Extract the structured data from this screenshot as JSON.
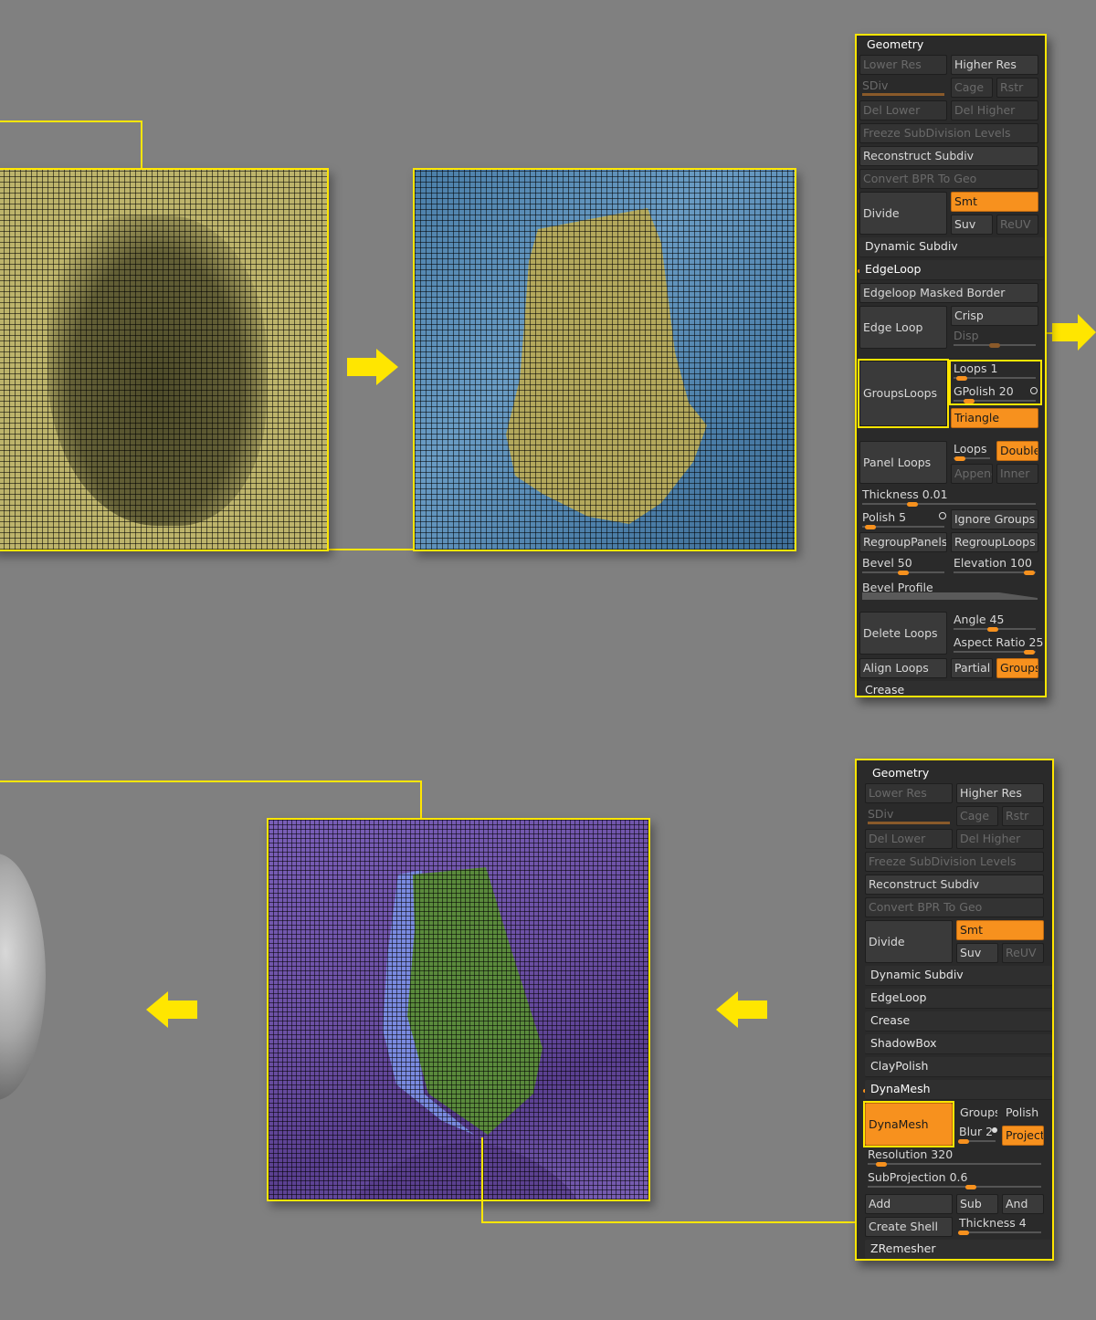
{
  "panel_top": {
    "title": "Geometry",
    "lower_res": "Lower Res",
    "higher_res": "Higher Res",
    "sdiv": "SDiv",
    "cage": "Cage",
    "rstr": "Rstr",
    "del_lower": "Del Lower",
    "del_higher": "Del Higher",
    "freeze": "Freeze SubDivision Levels",
    "reconstruct": "Reconstruct Subdiv",
    "convert": "Convert BPR To Geo",
    "divide": "Divide",
    "smt": "Smt",
    "suv": "Suv",
    "reuv": "ReUV",
    "dynamic_subdiv": "Dynamic Subdiv",
    "edgeloop": "EdgeLoop",
    "edgeloop_masked": "Edgeloop Masked Border",
    "edge_loop": "Edge Loop",
    "crisp": "Crisp",
    "disp": "Disp",
    "groupsloops": "GroupsLoops",
    "loops": "Loops 1",
    "gpolish": "GPolish 20",
    "triangle": "Triangle",
    "panel_loops": "Panel Loops",
    "pl_loops": "Loops",
    "double": "Double",
    "append": "Appenc",
    "inner": "Inner",
    "thickness": "Thickness 0.01",
    "polish": "Polish 5",
    "ignore_groups": "Ignore Groups",
    "regroup_panels": "RegroupPanels",
    "regroup_loops": "RegroupLoops",
    "bevel": "Bevel 50",
    "elevation": "Elevation 100",
    "bevel_profile": "Bevel Profile",
    "delete_loops": "Delete Loops",
    "angle": "Angle 45",
    "aspect": "Aspect Ratio 25",
    "align_loops": "Align Loops",
    "partial": "Partial",
    "groups": "Groups",
    "crease": "Crease"
  },
  "panel_bottom": {
    "title": "Geometry",
    "lower_res": "Lower Res",
    "higher_res": "Higher Res",
    "sdiv": "SDiv",
    "cage": "Cage",
    "rstr": "Rstr",
    "del_lower": "Del Lower",
    "del_higher": "Del Higher",
    "freeze": "Freeze SubDivision Levels",
    "reconstruct": "Reconstruct Subdiv",
    "convert": "Convert BPR To Geo",
    "divide": "Divide",
    "smt": "Smt",
    "suv": "Suv",
    "reuv": "ReUV",
    "dynamic_subdiv": "Dynamic Subdiv",
    "edgeloop": "EdgeLoop",
    "crease": "Crease",
    "shadowbox": "ShadowBox",
    "claypolish": "ClayPolish",
    "dynamesh_section": "DynaMesh",
    "dynamesh_btn": "DynaMesh",
    "groups": "Groups",
    "polish": "Polish",
    "blur": "Blur 2",
    "project": "Project",
    "resolution": "Resolution 320",
    "subprojection": "SubProjection 0.6",
    "add": "Add",
    "sub": "Sub",
    "and": "And",
    "create_shell": "Create Shell",
    "thickness": "Thickness 4",
    "zremesher": "ZRemesher"
  },
  "colors": {
    "highlight": "#ffe600",
    "accent": "#f7911e",
    "mesh_yellow": "#bdb46b",
    "mesh_blue": "#5b8fb8",
    "mesh_purple": "#6b4fa3",
    "mesh_green": "#5a8a3c"
  },
  "icons": [
    "arrow-right-icon",
    "arrow-left-icon"
  ]
}
